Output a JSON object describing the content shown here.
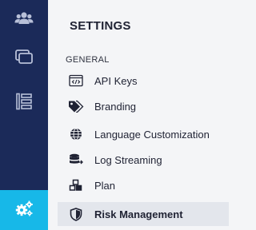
{
  "colors": {
    "rail_bg": "#1b2a59",
    "rail_active": "#17b8e8",
    "panel_bg": "#f4f5f7",
    "selected_bg": "#e3e6ec",
    "text": "#1f2233"
  },
  "rail": {
    "items": [
      {
        "icon": "users-icon"
      },
      {
        "icon": "windows-icon"
      },
      {
        "icon": "list-icon"
      },
      {
        "icon": "settings-gears-icon",
        "active": true
      }
    ]
  },
  "settings": {
    "title": "SETTINGS",
    "section": "GENERAL",
    "items": [
      {
        "label": "API Keys",
        "icon": "code-window-icon"
      },
      {
        "label": "Branding",
        "icon": "tag-icon"
      },
      {
        "label": "Language Customization",
        "icon": "globe-icon"
      },
      {
        "label": "Log Streaming",
        "icon": "database-icon"
      },
      {
        "label": "Plan",
        "icon": "boxes-icon"
      },
      {
        "label": "Risk Management",
        "icon": "shield-icon",
        "selected": true
      }
    ]
  }
}
